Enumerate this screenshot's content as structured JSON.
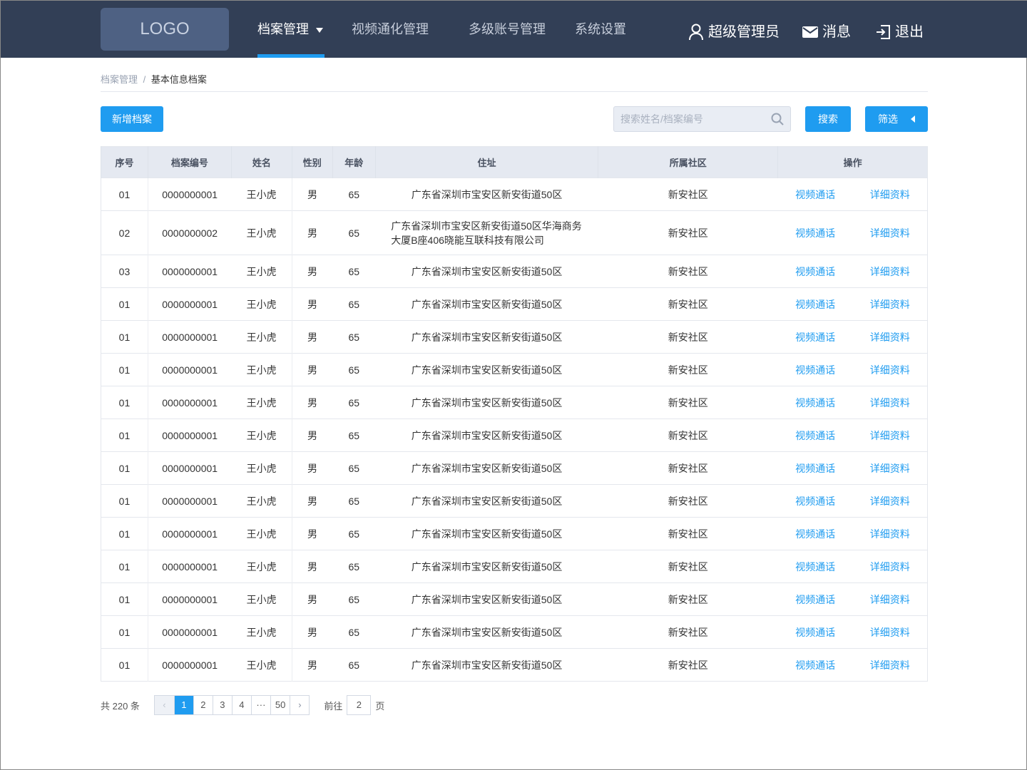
{
  "header": {
    "logo": "LOGO",
    "nav": [
      {
        "label": "档案管理"
      },
      {
        "label": "视频通化管理"
      },
      {
        "label": "多级账号管理"
      },
      {
        "label": "系统设置"
      }
    ],
    "user": "超级管理员",
    "messages": "消息",
    "logout": "退出"
  },
  "breadcrumb": {
    "parent": "档案管理",
    "sep": "/",
    "current": "基本信息档案"
  },
  "toolbar": {
    "add": "新增档案",
    "search_placeholder": "搜索姓名/档案编号",
    "search": "搜索",
    "filter": "筛选"
  },
  "table": {
    "headers": [
      "序号",
      "档案编号",
      "姓名",
      "性别",
      "年龄",
      "住址",
      "所属社区",
      "操作"
    ],
    "action_video": "视频通话",
    "action_detail": "详细资料",
    "rows": [
      [
        "01",
        "0000000001",
        "王小虎",
        "男",
        "65",
        "广东省深圳市宝安区新安街道50区",
        "新安社区"
      ],
      [
        "02",
        "0000000002",
        "王小虎",
        "男",
        "65",
        "广东省深圳市宝安区新安街道50区华海商务\n大厦B座406晓能互联科技有限公司",
        "新安社区"
      ],
      [
        "03",
        "0000000001",
        "王小虎",
        "男",
        "65",
        "广东省深圳市宝安区新安街道50区",
        "新安社区"
      ],
      [
        "01",
        "0000000001",
        "王小虎",
        "男",
        "65",
        "广东省深圳市宝安区新安街道50区",
        "新安社区"
      ],
      [
        "01",
        "0000000001",
        "王小虎",
        "男",
        "65",
        "广东省深圳市宝安区新安街道50区",
        "新安社区"
      ],
      [
        "01",
        "0000000001",
        "王小虎",
        "男",
        "65",
        "广东省深圳市宝安区新安街道50区",
        "新安社区"
      ],
      [
        "01",
        "0000000001",
        "王小虎",
        "男",
        "65",
        "广东省深圳市宝安区新安街道50区",
        "新安社区"
      ],
      [
        "01",
        "0000000001",
        "王小虎",
        "男",
        "65",
        "广东省深圳市宝安区新安街道50区",
        "新安社区"
      ],
      [
        "01",
        "0000000001",
        "王小虎",
        "男",
        "65",
        "广东省深圳市宝安区新安街道50区",
        "新安社区"
      ],
      [
        "01",
        "0000000001",
        "王小虎",
        "男",
        "65",
        "广东省深圳市宝安区新安街道50区",
        "新安社区"
      ],
      [
        "01",
        "0000000001",
        "王小虎",
        "男",
        "65",
        "广东省深圳市宝安区新安街道50区",
        "新安社区"
      ],
      [
        "01",
        "0000000001",
        "王小虎",
        "男",
        "65",
        "广东省深圳市宝安区新安街道50区",
        "新安社区"
      ],
      [
        "01",
        "0000000001",
        "王小虎",
        "男",
        "65",
        "广东省深圳市宝安区新安街道50区",
        "新安社区"
      ],
      [
        "01",
        "0000000001",
        "王小虎",
        "男",
        "65",
        "广东省深圳市宝安区新安街道50区",
        "新安社区"
      ],
      [
        "01",
        "0000000001",
        "王小虎",
        "男",
        "65",
        "广东省深圳市宝安区新安街道50区",
        "新安社区"
      ]
    ]
  },
  "pagination": {
    "total": "共 220 条",
    "prev": "‹",
    "pages": [
      "1",
      "2",
      "3",
      "4",
      "···",
      "50"
    ],
    "current": "1",
    "next": "›",
    "goto_label": "前往",
    "goto_value": "2",
    "page_suffix": "页"
  }
}
